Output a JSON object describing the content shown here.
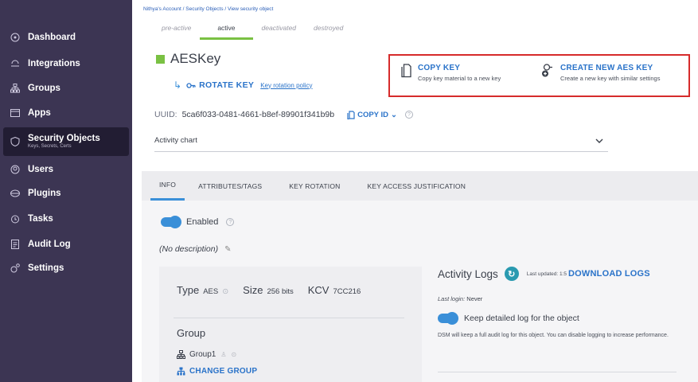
{
  "sidebar": {
    "items": [
      {
        "label": "Dashboard",
        "icon": "dashboard-icon"
      },
      {
        "label": "Integrations",
        "icon": "integrations-icon"
      },
      {
        "label": "Groups",
        "icon": "groups-icon"
      },
      {
        "label": "Apps",
        "icon": "apps-icon"
      },
      {
        "label": "Security Objects",
        "sub": "Keys, Secrets, Certs",
        "icon": "shield-icon"
      },
      {
        "label": "Users",
        "icon": "users-icon"
      },
      {
        "label": "Plugins",
        "icon": "plugins-icon"
      },
      {
        "label": "Tasks",
        "icon": "tasks-icon"
      },
      {
        "label": "Audit Log",
        "icon": "audit-log-icon"
      },
      {
        "label": "Settings",
        "icon": "settings-icon"
      }
    ]
  },
  "breadcrumb": "Nithya's Account  /  Security Objects  /  View security object",
  "lifecycle_tabs": [
    "pre-active",
    "active",
    "deactivated",
    "destroyed"
  ],
  "key": {
    "name": "AESKey",
    "rotate_label": "ROTATE KEY",
    "rotation_policy_link": "Key rotation policy",
    "uuid_label": "UUID:",
    "uuid": "5ca6f033-0481-4661-b8ef-89901f341b9b",
    "copy_id_label": "COPY ID"
  },
  "actions": {
    "copy_key": {
      "title": "COPY KEY",
      "desc": "Copy key material to a new key"
    },
    "create_aes": {
      "title": "CREATE NEW AES KEY",
      "desc": "Create a new key with similar settings"
    }
  },
  "activity_chart_label": "Activity chart",
  "tabs": [
    "INFO",
    "ATTRIBUTES/TAGS",
    "KEY ROTATION",
    "KEY ACCESS JUSTIFICATION"
  ],
  "info": {
    "enabled_label": "Enabled",
    "description": "(No description)",
    "type_key": "Type",
    "type_value": "AES",
    "size_key": "Size",
    "size_value": "256 bits",
    "kcv_key": "KCV",
    "kcv_value": "7CC216",
    "group_title": "Group",
    "group_name": "Group1",
    "change_group": "CHANGE GROUP"
  },
  "logs": {
    "title": "Activity Logs",
    "updated": "Last updated: 1:5",
    "download": "DOWNLOAD LOGS",
    "last_login_label": "Last login:",
    "last_login_value": "Never",
    "keep_label": "Keep detailed log for the object",
    "note": "DSM will keep a full audit log for this object. You can disable logging to increase performance."
  },
  "colors": {
    "sidebar": "#3c3553",
    "accent_blue": "#2a73c9",
    "accent_green": "#7ac143",
    "highlight_red": "#d62b2b"
  }
}
